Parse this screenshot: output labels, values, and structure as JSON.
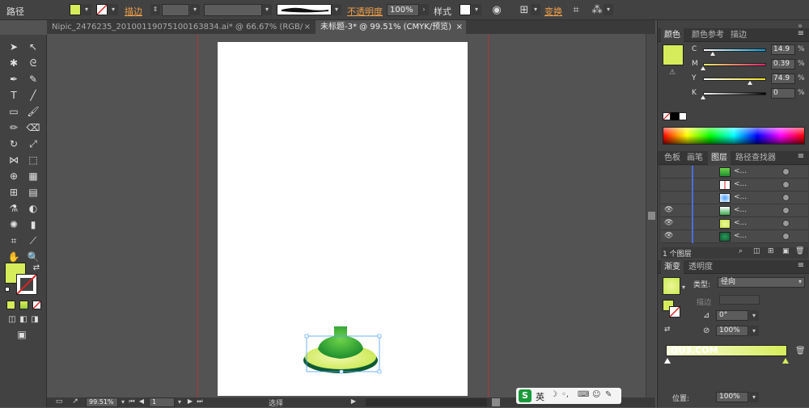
{
  "controlbar": {
    "path_label": "路径",
    "fill_color": "#d6ec5a",
    "stroke_label": "描边",
    "opacity_label": "不透明度",
    "opacity_value": "100%",
    "style_label": "样式",
    "transform_label": "变换"
  },
  "tabs": [
    {
      "label": "Nipic_2476235_20100119075100163834.ai* @ 66.67% (RGB/预览)"
    },
    {
      "label": "未标题-3* @ 99.51% (CMYK/预览)"
    }
  ],
  "color_panel": {
    "tabs": [
      "颜色",
      "颜色参考",
      "描边"
    ],
    "fill_swatch": "#d6ec5a",
    "channels": [
      {
        "name": "C",
        "value": "14.9",
        "fraction": 0.149,
        "gradient": "linear-gradient(to right,#fff,#00a0e0)"
      },
      {
        "name": "M",
        "value": "0.39",
        "fraction": 0.004,
        "gradient": "linear-gradient(to right,#e8f06a,#e0206a)"
      },
      {
        "name": "Y",
        "value": "74.9",
        "fraction": 0.749,
        "gradient": "linear-gradient(to right,#fff,#f0e020)"
      },
      {
        "name": "K",
        "value": "0",
        "fraction": 0.0,
        "gradient": "linear-gradient(to right,#fff,#000)"
      }
    ],
    "unit": "%"
  },
  "layers_panel": {
    "tabs": [
      "色板",
      "画笔",
      "图层",
      "路径查找器"
    ],
    "rows": [
      {
        "name": "<...",
        "visible": false
      },
      {
        "name": "<...",
        "visible": false
      },
      {
        "name": "<...",
        "visible": false
      },
      {
        "name": "<...",
        "visible": true
      },
      {
        "name": "<...",
        "visible": true
      },
      {
        "name": "<...",
        "visible": true
      }
    ],
    "footer": "1 个图层"
  },
  "gradient_panel": {
    "tabs": [
      "渐变",
      "透明度"
    ],
    "type_label": "类型:",
    "type_value": "径向",
    "stroke_label": "描边",
    "angle_value": "0°",
    "ratio_value": "100%",
    "position_label": "位置:",
    "position_value": "100%"
  },
  "statusbar": {
    "zoom": "99.51%",
    "page": "1",
    "status": "选择"
  },
  "ime": {
    "label": "英"
  },
  "watermark": "QU3.COM"
}
